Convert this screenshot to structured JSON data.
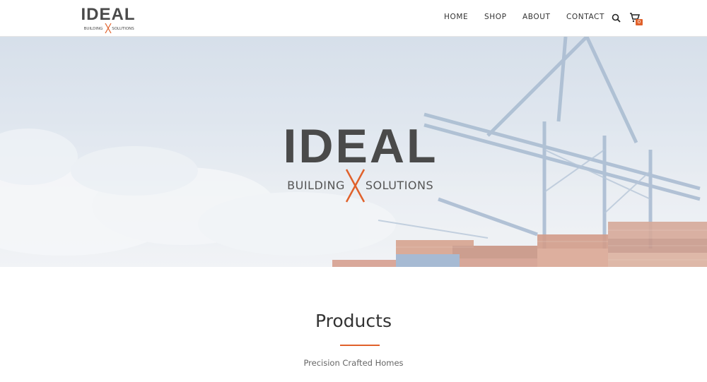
{
  "brand": {
    "wordmark": "IDEAL",
    "left_word": "BUILDING",
    "right_word": "SOLUTIONS",
    "accent_color": "#e0612b",
    "text_color": "#4a4a4a"
  },
  "nav": {
    "items": [
      {
        "label": "HOME"
      },
      {
        "label": "SHOP"
      },
      {
        "label": "ABOUT"
      },
      {
        "label": "CONTACT"
      }
    ],
    "search_icon": "search-icon",
    "cart_icon": "shopping-cart-icon",
    "cart_count": "0"
  },
  "hero": {
    "image": "port-crane-containers"
  },
  "products": {
    "title": "Products",
    "subtitle": "Precision Crafted Homes"
  }
}
